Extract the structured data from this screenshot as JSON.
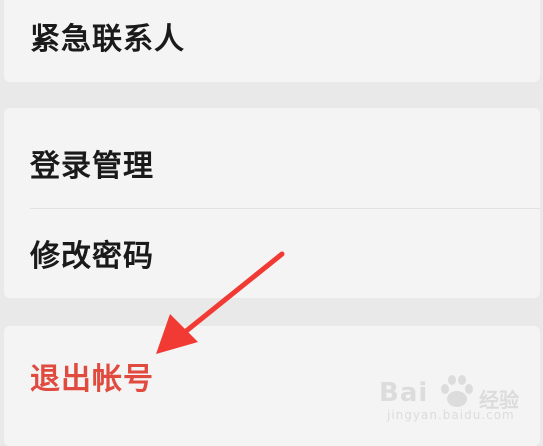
{
  "settings": {
    "emergency_contact": "紧急联系人",
    "login_management": "登录管理",
    "change_password": "修改密码",
    "logout": "退出帐号"
  },
  "watermark": {
    "brand": "Bai",
    "sub": "经验",
    "url": "jingyan.baidu.com"
  },
  "colors": {
    "background": "#e9e9e9",
    "card": "#f4f4f4",
    "text": "#1a1a1a",
    "logout_text": "#e04a3f",
    "arrow": "#f23a34"
  },
  "icons": {
    "annotation": "red-arrow-pointing-to-logout",
    "watermark_logo": "baidu-paw-logo"
  }
}
